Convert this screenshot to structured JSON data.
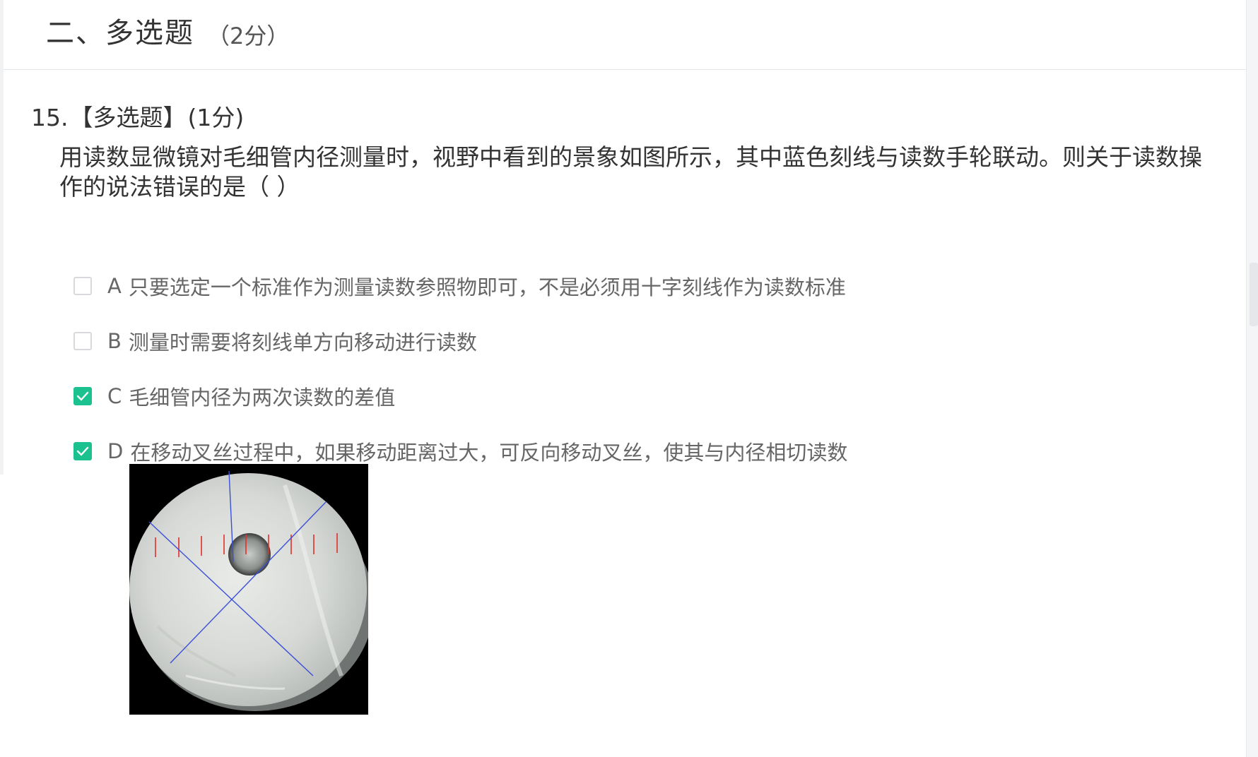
{
  "section": {
    "title": "二、多选题",
    "score": "（2分）"
  },
  "question": {
    "number": "15.",
    "type": "【多选题】",
    "score": "(1分)",
    "text": "用读数显微镜对毛细管内径测量时，视野中看到的景象如图所示，其中蓝色刻线与读数手轮联动。则关于读数操作的说法错误的是（   ）"
  },
  "options": [
    {
      "letter": "A",
      "text": "只要选定一个标准作为测量读数参照物即可，不是必须用十字刻线作为读数标准",
      "checked": false
    },
    {
      "letter": "B",
      "text": "测量时需要将刻线单方向移动进行读数",
      "checked": false
    },
    {
      "letter": "C",
      "text": "毛细管内径为两次读数的差值",
      "checked": true
    },
    {
      "letter": "D",
      "text": "在移动叉丝过程中，如果移动距离过大，可反向移动叉丝，使其与内径相切读数",
      "checked": true
    }
  ],
  "colors": {
    "checkbox_checked": "#1bc28f",
    "checkbox_border": "#d7d9dd",
    "crosshair": "#3a4fd8",
    "scale_marks": "#e0302a"
  },
  "icons": {
    "check": "check-icon"
  }
}
